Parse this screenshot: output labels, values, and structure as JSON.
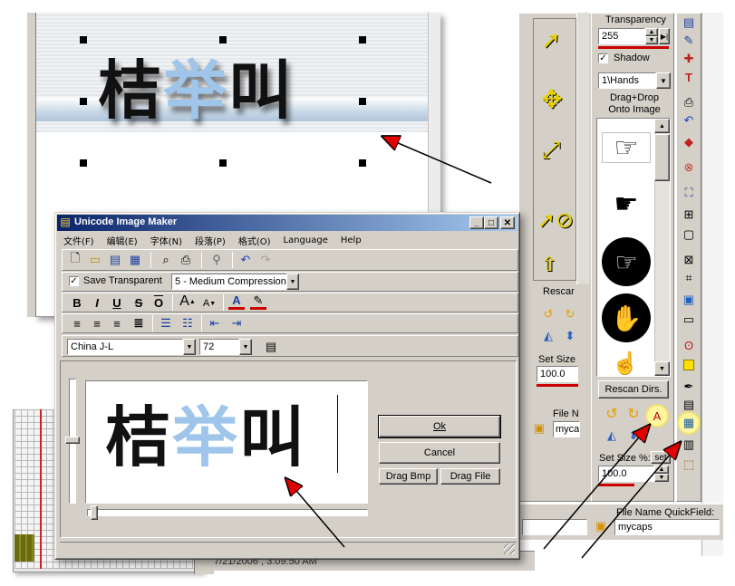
{
  "background_preview": {
    "text": "桔举叫"
  },
  "tool_panel": {
    "transparency_label": "Transparency",
    "transparency_value": "255",
    "shadow_label": "Shadow",
    "folder_value": "1\\Hands",
    "dragdrop_label": "Drag+Drop Onto Image",
    "rescan_button": "Rescan Dirs.",
    "set_size_label": "Set Size %:",
    "set_button": "set",
    "size_value": "100.0",
    "quickfield_label": "File Name QuickField:",
    "quickfield_value": "mycaps"
  },
  "middle_panel": {
    "rescan_partial": "Rescar",
    "set_size_partial": "Set Size",
    "size_value": "100.0",
    "file_label_partial": "File N",
    "file_value_partial": "myca"
  },
  "status": {
    "timestamp": "7/21/2006 , 3:09:50 AM"
  },
  "dialog": {
    "title": "Unicode Image Maker",
    "menu": [
      "文件(F)",
      "编辑(E)",
      "字体(N)",
      "段落(P)",
      "格式(O)",
      "Language",
      "Help"
    ],
    "save_transparent_label": "Save Transparent",
    "compression_value": "5 - Medium Compression",
    "font_name": "China J-L",
    "font_size": "72",
    "preview_text": "桔举叫",
    "ok_button": "Ok",
    "cancel_button": "Cancel",
    "drag_bmp_button": "Drag Bmp",
    "drag_file_button": "Drag File"
  },
  "colors": {
    "highlight_blue": "#9fc5ea",
    "accent_red": "#cc0000",
    "face": "#d4d0c8",
    "title_gradient_start": "#0a246a",
    "title_gradient_end": "#a6caf0"
  }
}
